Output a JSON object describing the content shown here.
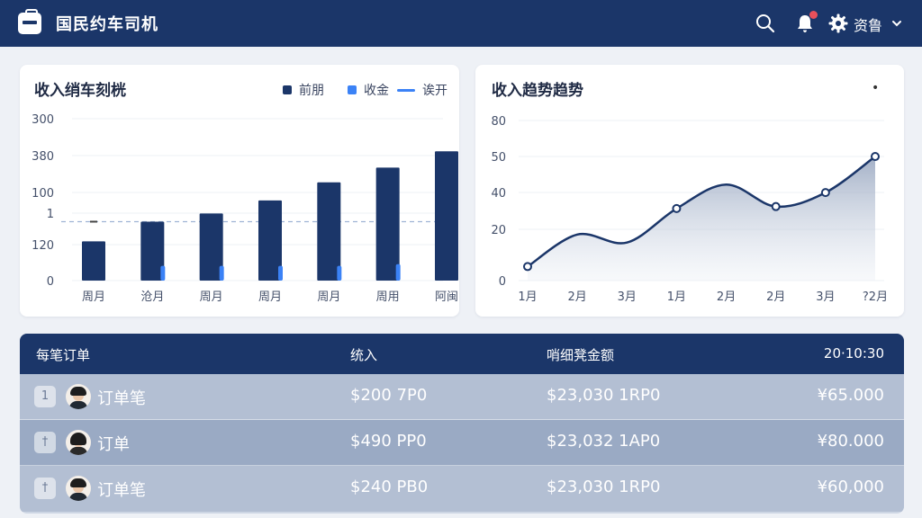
{
  "app": {
    "title": "国民约车司机"
  },
  "header": {
    "user_name": "资鲁",
    "icons": [
      "briefcase-icon",
      "search-icon",
      "bell-icon",
      "gear-icon",
      "chevron-down-icon"
    ],
    "notification_dot": true
  },
  "colors": {
    "primary": "#1b3669",
    "accent": "#3b82f6",
    "danger": "#e8505b"
  },
  "card_left": {
    "title": "收入绡车刻桄",
    "legend": [
      "前朋",
      "收金",
      "诶开"
    ],
    "more_icon": ""
  },
  "card_right": {
    "title": "收入趋势趋势",
    "more_icon": "•"
  },
  "chart_data": [
    {
      "type": "bar",
      "categories": [
        "周月",
        "沧月",
        "周月",
        "周月",
        "周月",
        "周用",
        "阿闽"
      ],
      "yticks": [
        "0",
        "120",
        "1",
        "100",
        "380",
        "300"
      ],
      "series": [
        {
          "name": "前朋",
          "values": [
            0.24,
            0.36,
            0.41,
            0.49,
            0.6,
            0.69,
            0.79
          ]
        },
        {
          "name": "收金",
          "values": [
            0,
            0.09,
            0.09,
            0.09,
            0.09,
            0.1,
            0
          ]
        }
      ],
      "reference_line": {
        "name": "诶开",
        "value": 0.36
      },
      "value_scale_note": "",
      "ylim": [
        0,
        1
      ]
    },
    {
      "type": "area",
      "categories": [
        "1月",
        "2月",
        "3月",
        "1月",
        "2月",
        "2月",
        "3月",
        "?2月"
      ],
      "yticks": [
        "0",
        "20",
        "40",
        "50",
        "80"
      ],
      "values": [
        7,
        23,
        19,
        36,
        48,
        37,
        44,
        62
      ],
      "marked_points": [
        0,
        3,
        5,
        6,
        7
      ],
      "ylim": [
        0,
        80
      ]
    }
  ],
  "table": {
    "headers": [
      "每笔订单",
      "统入",
      "哨细凳金额",
      "20·10:30"
    ],
    "rows": [
      {
        "index": "1",
        "name": "订单笔",
        "income": "$200 7P0",
        "detail": "$23,030 1RP0",
        "amount": "¥65.000"
      },
      {
        "index": "†",
        "name": "订单",
        "income": "$490 PP0",
        "detail": "$23,032 1AP0",
        "amount": "¥80.000"
      },
      {
        "index": "†",
        "name": "订单笔",
        "income": "$240 PB0",
        "detail": "$23,030 1RP0",
        "amount": "¥60,000"
      }
    ]
  }
}
